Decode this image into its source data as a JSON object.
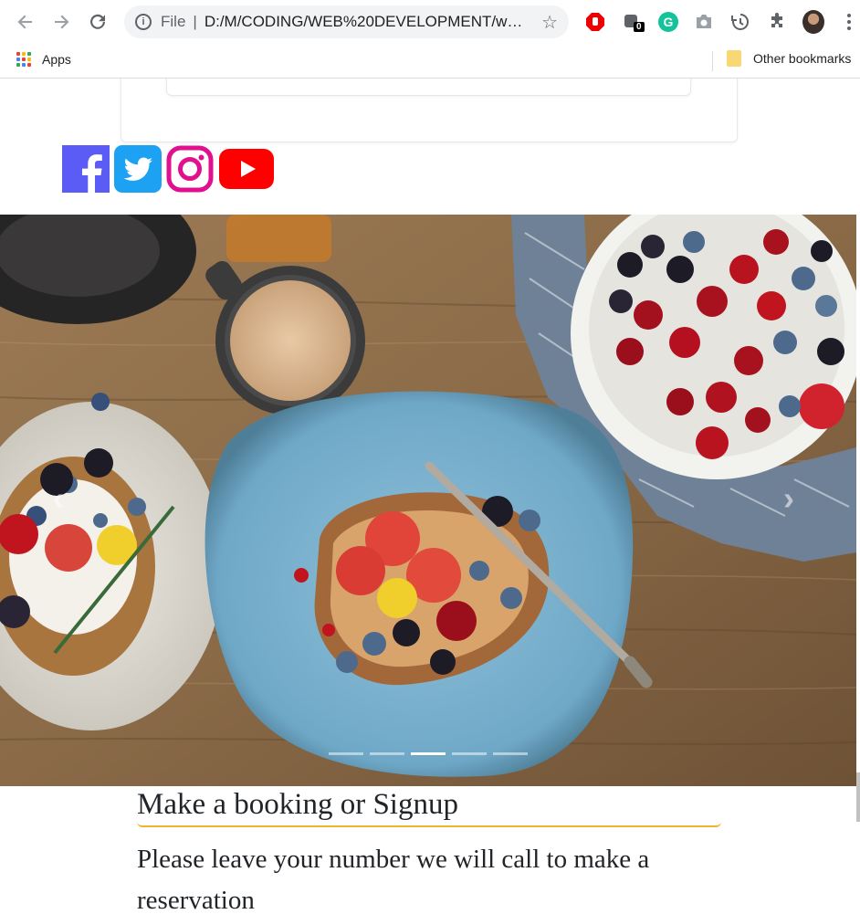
{
  "browser": {
    "scheme": "File",
    "url": "D:/M/CODING/WEB%20DEVELOPMENT/website/index.html",
    "ext_badge": "0",
    "grammarly_letter": "G"
  },
  "bookmarks": {
    "apps_label": "Apps",
    "other_label": "Other bookmarks"
  },
  "social": [
    "facebook",
    "twitter",
    "instagram",
    "youtube"
  ],
  "carousel": {
    "slide_count": 5,
    "active_index": 2,
    "prev_glyph": "‹",
    "next_glyph": "›"
  },
  "booking": {
    "title": "Make a booking or Signup",
    "text": "Please leave your number we will call to make a reservation"
  },
  "colors": {
    "accent_underline": "#f0b429",
    "facebook": "#5b5bf5",
    "twitter": "#1da1f2",
    "instagram": "#e1108f",
    "youtube": "#ff0000"
  }
}
